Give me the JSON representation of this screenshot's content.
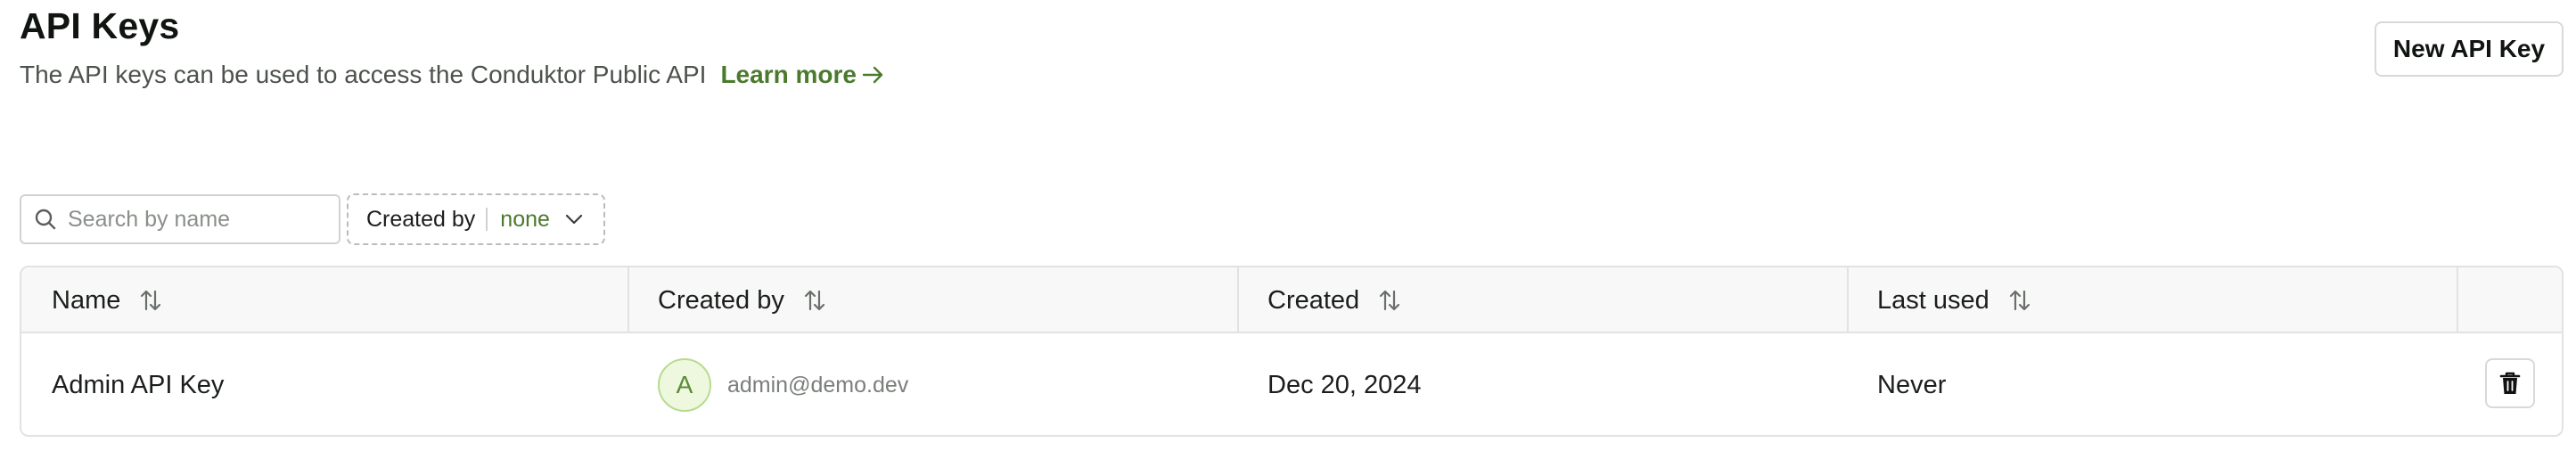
{
  "header": {
    "title": "API Keys",
    "subtitle": "The API keys can be used to access the Conduktor Public API",
    "learn_more": "Learn more",
    "new_key_label": "New API Key"
  },
  "filters": {
    "search_placeholder": "Search by name",
    "created_by_label": "Created by",
    "created_by_value": "none"
  },
  "table": {
    "columns": [
      "Name",
      "Created by",
      "Created",
      "Last used"
    ],
    "rows": [
      {
        "name": "Admin API Key",
        "avatar_initial": "A",
        "created_by": "admin@demo.dev",
        "created": "Dec 20, 2024",
        "last_used": "Never"
      }
    ]
  },
  "icons": {
    "search": "search-icon",
    "arrow": "arrow-right-icon",
    "chevron": "chevron-down-icon",
    "sort": "sort-icon",
    "delete": "trash-icon"
  },
  "colors": {
    "accent": "#4b7a2d",
    "avatar_bg": "#eef8df",
    "border": "#e0e3e0"
  }
}
